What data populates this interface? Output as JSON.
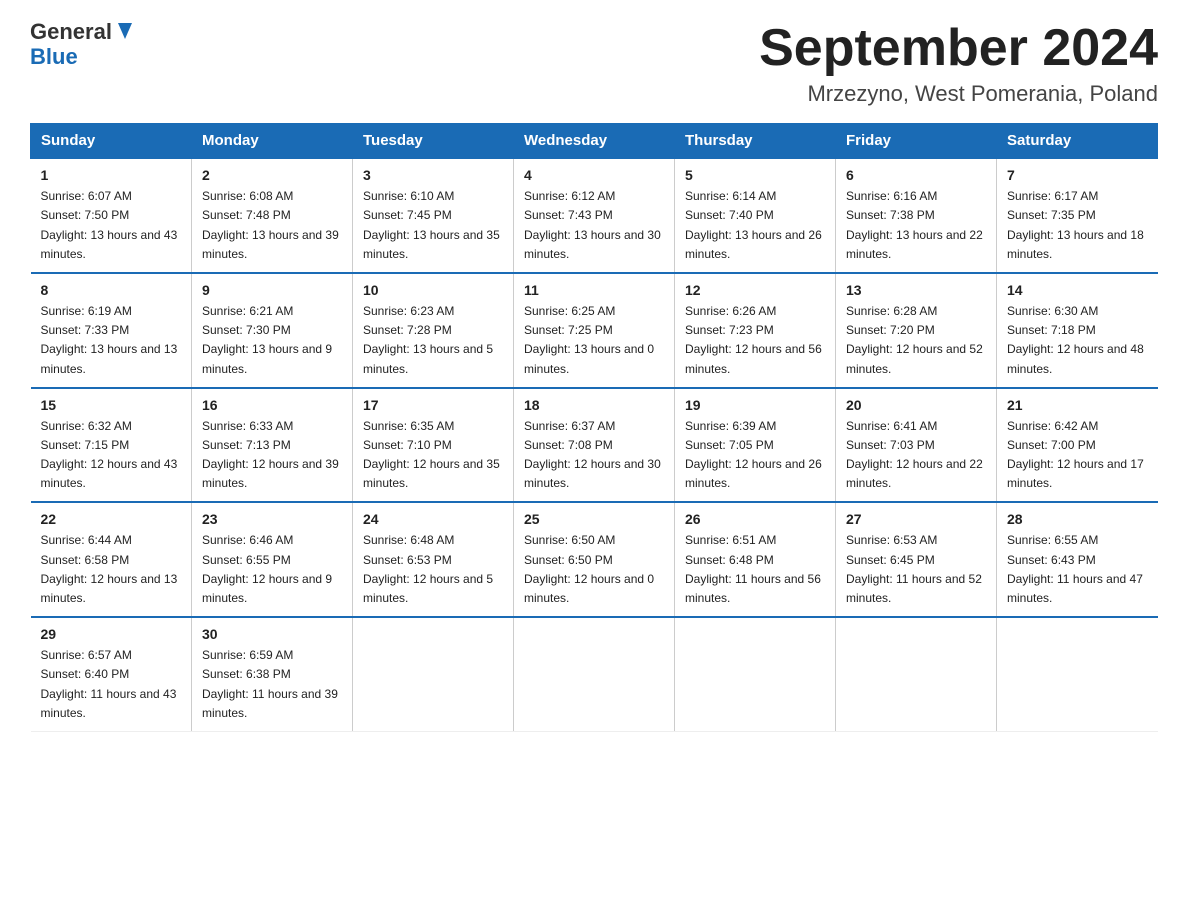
{
  "header": {
    "logo_line1": "General",
    "logo_line2": "Blue",
    "month_title": "September 2024",
    "location": "Mrzezyno, West Pomerania, Poland"
  },
  "weekdays": [
    "Sunday",
    "Monday",
    "Tuesday",
    "Wednesday",
    "Thursday",
    "Friday",
    "Saturday"
  ],
  "weeks": [
    [
      {
        "day": "1",
        "sunrise": "6:07 AM",
        "sunset": "7:50 PM",
        "daylight": "13 hours and 43 minutes."
      },
      {
        "day": "2",
        "sunrise": "6:08 AM",
        "sunset": "7:48 PM",
        "daylight": "13 hours and 39 minutes."
      },
      {
        "day": "3",
        "sunrise": "6:10 AM",
        "sunset": "7:45 PM",
        "daylight": "13 hours and 35 minutes."
      },
      {
        "day": "4",
        "sunrise": "6:12 AM",
        "sunset": "7:43 PM",
        "daylight": "13 hours and 30 minutes."
      },
      {
        "day": "5",
        "sunrise": "6:14 AM",
        "sunset": "7:40 PM",
        "daylight": "13 hours and 26 minutes."
      },
      {
        "day": "6",
        "sunrise": "6:16 AM",
        "sunset": "7:38 PM",
        "daylight": "13 hours and 22 minutes."
      },
      {
        "day": "7",
        "sunrise": "6:17 AM",
        "sunset": "7:35 PM",
        "daylight": "13 hours and 18 minutes."
      }
    ],
    [
      {
        "day": "8",
        "sunrise": "6:19 AM",
        "sunset": "7:33 PM",
        "daylight": "13 hours and 13 minutes."
      },
      {
        "day": "9",
        "sunrise": "6:21 AM",
        "sunset": "7:30 PM",
        "daylight": "13 hours and 9 minutes."
      },
      {
        "day": "10",
        "sunrise": "6:23 AM",
        "sunset": "7:28 PM",
        "daylight": "13 hours and 5 minutes."
      },
      {
        "day": "11",
        "sunrise": "6:25 AM",
        "sunset": "7:25 PM",
        "daylight": "13 hours and 0 minutes."
      },
      {
        "day": "12",
        "sunrise": "6:26 AM",
        "sunset": "7:23 PM",
        "daylight": "12 hours and 56 minutes."
      },
      {
        "day": "13",
        "sunrise": "6:28 AM",
        "sunset": "7:20 PM",
        "daylight": "12 hours and 52 minutes."
      },
      {
        "day": "14",
        "sunrise": "6:30 AM",
        "sunset": "7:18 PM",
        "daylight": "12 hours and 48 minutes."
      }
    ],
    [
      {
        "day": "15",
        "sunrise": "6:32 AM",
        "sunset": "7:15 PM",
        "daylight": "12 hours and 43 minutes."
      },
      {
        "day": "16",
        "sunrise": "6:33 AM",
        "sunset": "7:13 PM",
        "daylight": "12 hours and 39 minutes."
      },
      {
        "day": "17",
        "sunrise": "6:35 AM",
        "sunset": "7:10 PM",
        "daylight": "12 hours and 35 minutes."
      },
      {
        "day": "18",
        "sunrise": "6:37 AM",
        "sunset": "7:08 PM",
        "daylight": "12 hours and 30 minutes."
      },
      {
        "day": "19",
        "sunrise": "6:39 AM",
        "sunset": "7:05 PM",
        "daylight": "12 hours and 26 minutes."
      },
      {
        "day": "20",
        "sunrise": "6:41 AM",
        "sunset": "7:03 PM",
        "daylight": "12 hours and 22 minutes."
      },
      {
        "day": "21",
        "sunrise": "6:42 AM",
        "sunset": "7:00 PM",
        "daylight": "12 hours and 17 minutes."
      }
    ],
    [
      {
        "day": "22",
        "sunrise": "6:44 AM",
        "sunset": "6:58 PM",
        "daylight": "12 hours and 13 minutes."
      },
      {
        "day": "23",
        "sunrise": "6:46 AM",
        "sunset": "6:55 PM",
        "daylight": "12 hours and 9 minutes."
      },
      {
        "day": "24",
        "sunrise": "6:48 AM",
        "sunset": "6:53 PM",
        "daylight": "12 hours and 5 minutes."
      },
      {
        "day": "25",
        "sunrise": "6:50 AM",
        "sunset": "6:50 PM",
        "daylight": "12 hours and 0 minutes."
      },
      {
        "day": "26",
        "sunrise": "6:51 AM",
        "sunset": "6:48 PM",
        "daylight": "11 hours and 56 minutes."
      },
      {
        "day": "27",
        "sunrise": "6:53 AM",
        "sunset": "6:45 PM",
        "daylight": "11 hours and 52 minutes."
      },
      {
        "day": "28",
        "sunrise": "6:55 AM",
        "sunset": "6:43 PM",
        "daylight": "11 hours and 47 minutes."
      }
    ],
    [
      {
        "day": "29",
        "sunrise": "6:57 AM",
        "sunset": "6:40 PM",
        "daylight": "11 hours and 43 minutes."
      },
      {
        "day": "30",
        "sunrise": "6:59 AM",
        "sunset": "6:38 PM",
        "daylight": "11 hours and 39 minutes."
      },
      null,
      null,
      null,
      null,
      null
    ]
  ]
}
